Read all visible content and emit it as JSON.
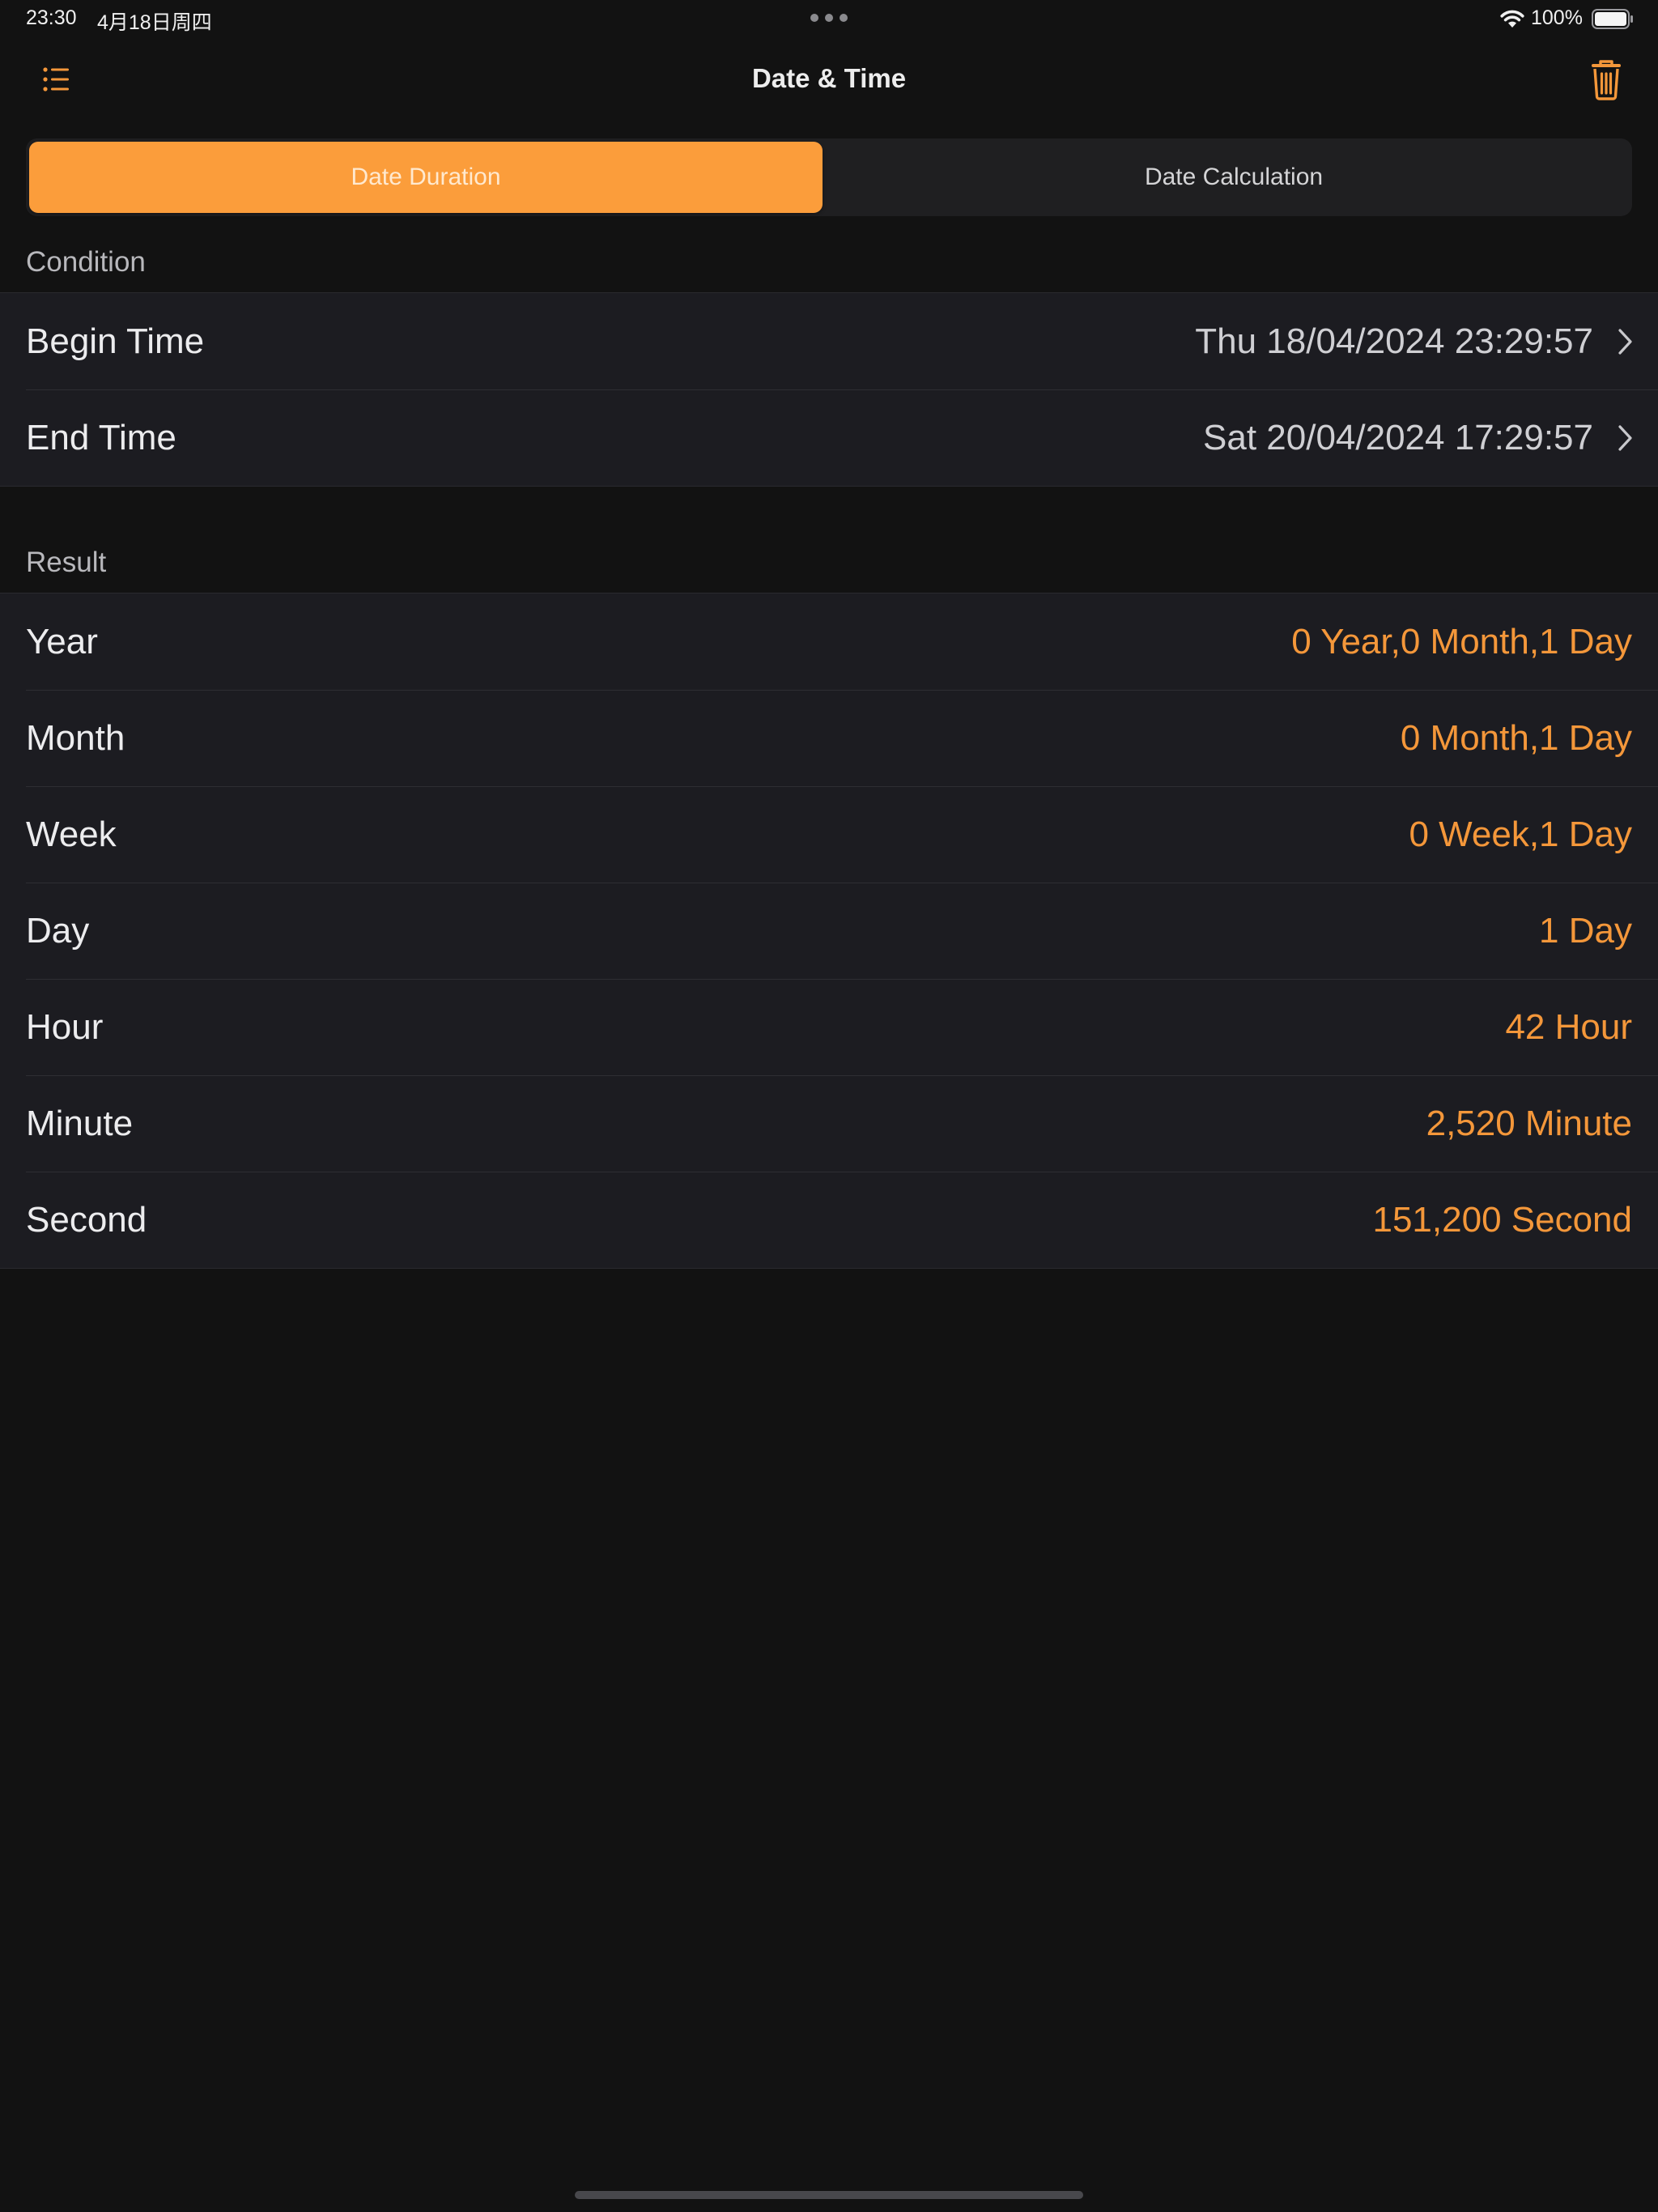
{
  "status_bar": {
    "time": "23:30",
    "date": "4月18日周四",
    "battery": "100%",
    "icons": [
      "multitasking-dots-icon",
      "wifi-icon",
      "battery-icon"
    ]
  },
  "nav": {
    "title": "Date & Time",
    "left_icon": "list-icon",
    "right_icon": "trash-icon"
  },
  "tabs": [
    {
      "label": "Date Duration",
      "selected": true
    },
    {
      "label": "Date Calculation",
      "selected": false
    }
  ],
  "condition": {
    "header": "Condition",
    "rows": [
      {
        "label": "Begin Time",
        "value": "Thu 18/04/2024 23:29:57"
      },
      {
        "label": "End Time",
        "value": "Sat 20/04/2024 17:29:57"
      }
    ]
  },
  "result": {
    "header": "Result",
    "rows": [
      {
        "label": "Year",
        "value": "0 Year,0 Month,1 Day"
      },
      {
        "label": "Month",
        "value": "0 Month,1 Day"
      },
      {
        "label": "Week",
        "value": "0 Week,1 Day"
      },
      {
        "label": "Day",
        "value": "1 Day"
      },
      {
        "label": "Hour",
        "value": "42 Hour"
      },
      {
        "label": "Minute",
        "value": "2,520 Minute"
      },
      {
        "label": "Second",
        "value": "151,200 Second"
      }
    ]
  },
  "colors": {
    "accent": "#fb9d3b",
    "result_text": "#f4973a",
    "background": "#121212",
    "cell": "#1c1c21"
  }
}
